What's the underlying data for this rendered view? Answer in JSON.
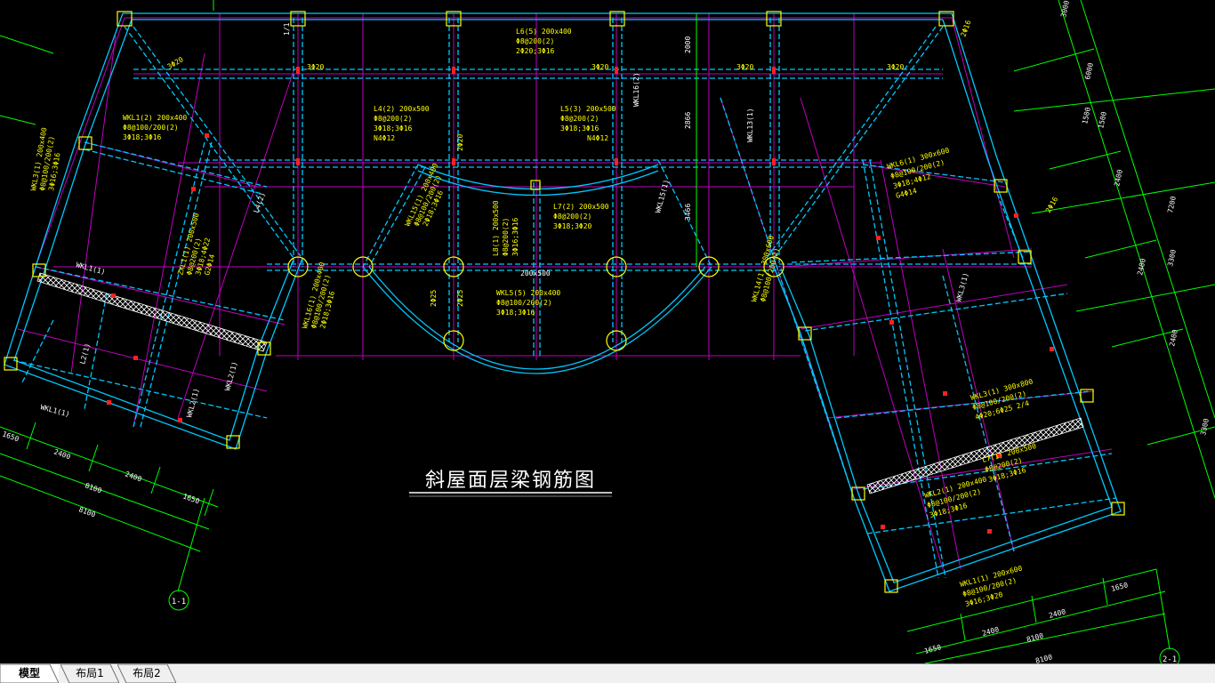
{
  "drawing": {
    "title": "斜屋面层梁钢筋图",
    "beams": [
      {
        "id": "l6",
        "text": "L6(5) 200x400"
      },
      {
        "id": "l6b",
        "text": "Φ8@200(2)"
      },
      {
        "id": "l6c",
        "text": "2Φ20;3Φ16"
      },
      {
        "id": "l4",
        "text": "L4(2) 200x500"
      },
      {
        "id": "l4b",
        "text": "Φ8@200(2)"
      },
      {
        "id": "l4c",
        "text": "3Φ18;3Φ16"
      },
      {
        "id": "l4d",
        "text": "N4Φ12"
      },
      {
        "id": "l5",
        "text": "L5(3) 200x500"
      },
      {
        "id": "l5b",
        "text": "Φ8@200(2)"
      },
      {
        "id": "l5c",
        "text": "3Φ18;3Φ16"
      },
      {
        "id": "l5d",
        "text": "N4Φ12"
      },
      {
        "id": "wkl1",
        "text": "WKL1(2) 200x400"
      },
      {
        "id": "wkl1b",
        "text": "Φ8@100/200(2)"
      },
      {
        "id": "wkl1c",
        "text": "3Φ18;3Φ16"
      },
      {
        "id": "wkl3",
        "text": "WKL3(1) 200x400"
      },
      {
        "id": "wkl3b",
        "text": "Φ8@100/200(2)"
      },
      {
        "id": "wkl3c",
        "text": "3Φ16;3Φ16"
      },
      {
        "id": "wkl6",
        "text": "WKL6(1) 300x600"
      },
      {
        "id": "wkl6b",
        "text": "Φ8@100/200(2)"
      },
      {
        "id": "wkl6c",
        "text": "3Φ18;4Φ12"
      },
      {
        "id": "wkl6d",
        "text": "G4Φ14"
      },
      {
        "id": "zxl1",
        "text": "ZXL1(1) 200x500"
      },
      {
        "id": "zxl1b",
        "text": "Φ8@200(2)"
      },
      {
        "id": "zxl1c",
        "text": "3Φ18;4Φ22"
      },
      {
        "id": "zxl1d",
        "text": "G2Φ14"
      },
      {
        "id": "l7",
        "text": "L7(2) 200x500"
      },
      {
        "id": "l7b",
        "text": "Φ8@200(2)"
      },
      {
        "id": "l7c",
        "text": "3Φ18;3Φ20"
      },
      {
        "id": "wkl5",
        "text": "WKL5(5) 200x400"
      },
      {
        "id": "wkl5b",
        "text": "Φ8@100/200(2)"
      },
      {
        "id": "wkl5c",
        "text": "3Φ18;3Φ16"
      },
      {
        "id": "l8",
        "text": "L8(1) 200x500"
      },
      {
        "id": "l8b",
        "text": "Φ8@200(2)"
      },
      {
        "id": "l8c",
        "text": "3Φ16;3Φ16"
      },
      {
        "id": "wkl31",
        "text": "WKL3(1) 300x800"
      },
      {
        "id": "wkl31b",
        "text": "Φ8@100/200(2)"
      },
      {
        "id": "wkl31c",
        "text": "4Φ20;6Φ25 2/4"
      },
      {
        "id": "lz",
        "text": "L7(1) 200x500"
      },
      {
        "id": "lzb",
        "text": "Φ8@200(2)"
      },
      {
        "id": "lzc",
        "text": "3Φ18;3Φ16"
      },
      {
        "id": "wkl11",
        "text": "WKL1(1) 200x600"
      },
      {
        "id": "wkl11b",
        "text": "Φ8@100/200(2)"
      },
      {
        "id": "wkl11c",
        "text": "3Φ16;3Φ20"
      },
      {
        "id": "wkl21",
        "text": "WKL2(1) 200x400"
      },
      {
        "id": "wkl21b",
        "text": "Φ8@100/200(2)"
      },
      {
        "id": "wkl21c",
        "text": "3Φ18;3Φ16"
      },
      {
        "id": "wkl14",
        "text": "WKL14(1) 300x600"
      },
      {
        "id": "wkl14b",
        "text": "Φ8@100/200(2)"
      },
      {
        "id": "wkl15",
        "text": "WKL15(1) 200x400"
      },
      {
        "id": "wkl15b",
        "text": "Φ8@100/200(2)"
      },
      {
        "id": "wkl15c",
        "text": "2Φ18;3Φ16"
      },
      {
        "id": "wkl16",
        "text": "WKL16(1) 200x400"
      },
      {
        "id": "wkl16b",
        "text": "Φ8@100/200(2)"
      },
      {
        "id": "wkl16c",
        "text": "2Φ18;3Φ16"
      }
    ],
    "bar_labels": [
      "3Φ20",
      "3Φ20",
      "3Φ20",
      "3Φ20",
      "2Φ20",
      "3Φ20",
      "2Φ16",
      "2Φ16",
      "2Φ25",
      "2Φ25"
    ],
    "dims": {
      "left_bottom": [
        "1650",
        "2400",
        "2400",
        "1650"
      ],
      "left_total": [
        "8100",
        "8100"
      ],
      "right_bottom": [
        "1650",
        "2400",
        "2400",
        "1650"
      ],
      "right_total": [
        "8100",
        "8100"
      ],
      "right_side": [
        "3000",
        "6000",
        "1500",
        "1500",
        "2400",
        "2400",
        "7200",
        "3300",
        "2400",
        "3300"
      ],
      "center_vert": [
        "2000",
        "2866",
        "3466"
      ],
      "center_size": "200x500"
    },
    "axis_tags": [
      "1-1",
      "2-1"
    ],
    "side_labels": [
      "1/1",
      "L4(2)",
      "WKL1(1)",
      "WKL1(1)",
      "L2(1)",
      "WKL2(1)",
      "WKL2(1)",
      "WKL13(1)",
      "WKL15(1)",
      "WKL16(2)",
      "WKL3(1)"
    ]
  },
  "tabs": [
    {
      "label": "模型",
      "active": true
    },
    {
      "label": "布局1",
      "active": false
    },
    {
      "label": "布局2",
      "active": false
    }
  ],
  "colors": {
    "background": "#000000",
    "beam": "#00c8ff",
    "grid": "#c000c0",
    "text": "#ffff00",
    "dim": "#00ff00",
    "white": "#ffffff",
    "red": "#ff2020"
  }
}
